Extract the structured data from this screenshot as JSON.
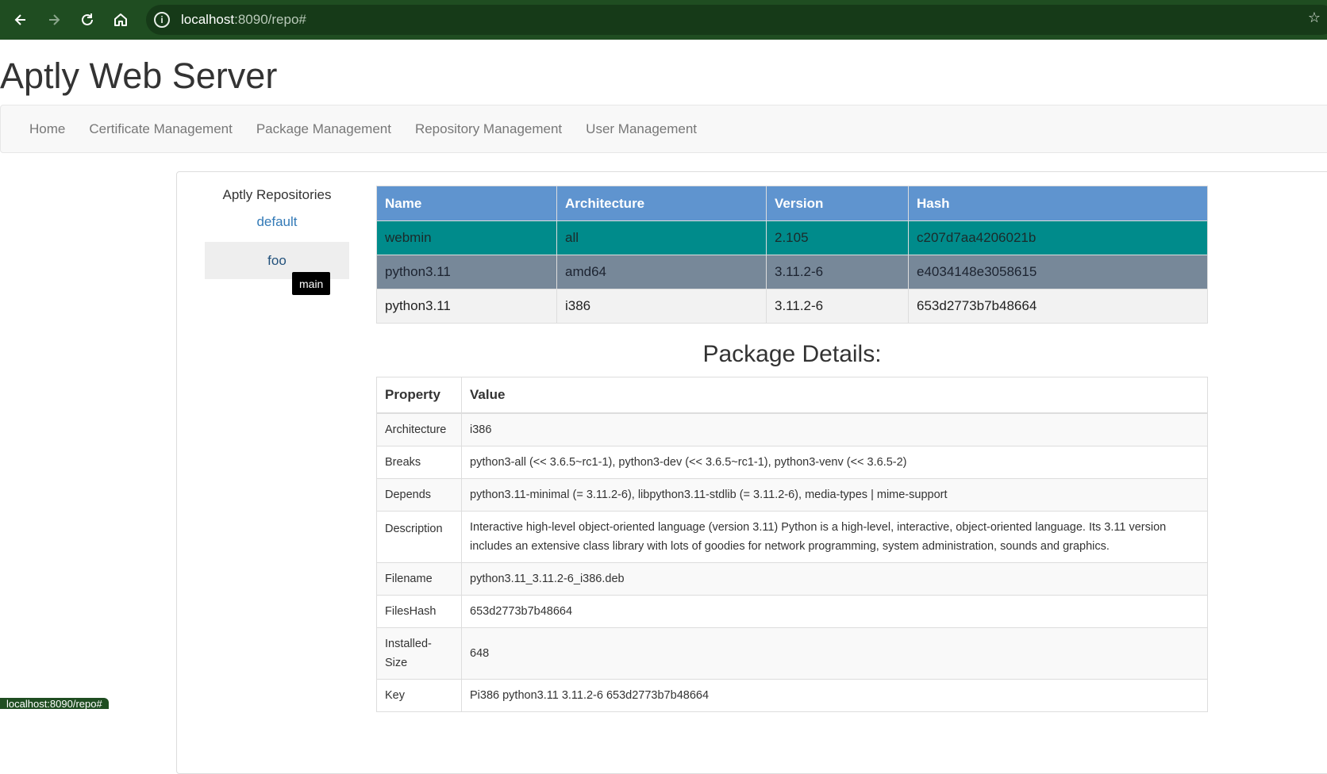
{
  "browser": {
    "url_host": "localhost",
    "url_rest": ":8090/repo#"
  },
  "page": {
    "title": "Aptly Web Server"
  },
  "nav": {
    "items": [
      {
        "label": "Home"
      },
      {
        "label": "Certificate Management"
      },
      {
        "label": "Package Management"
      },
      {
        "label": "Repository Management"
      },
      {
        "label": "User Management"
      }
    ]
  },
  "sidebar": {
    "heading": "Aptly Repositories",
    "repos": [
      "default",
      "foo"
    ],
    "tooltip": "main"
  },
  "packages": {
    "headers": [
      "Name",
      "Architecture",
      "Version",
      "Hash"
    ],
    "rows": [
      [
        "webmin",
        "all",
        "2.105",
        "c207d7aa4206021b"
      ],
      [
        "python3.11",
        "amd64",
        "3.11.2-6",
        "e4034148e3058615"
      ],
      [
        "python3.11",
        "i386",
        "3.11.2-6",
        "653d2773b7b48664"
      ]
    ]
  },
  "details": {
    "title": "Package Details:",
    "headers": [
      "Property",
      "Value"
    ],
    "rows": [
      [
        "Architecture",
        "i386"
      ],
      [
        "Breaks",
        "python3-all (<< 3.6.5~rc1-1), python3-dev (<< 3.6.5~rc1-1), python3-venv (<< 3.6.5-2)"
      ],
      [
        "Depends",
        "python3.11-minimal (= 3.11.2-6), libpython3.11-stdlib (= 3.11.2-6), media-types | mime-support"
      ],
      [
        "Description",
        "Interactive high-level object-oriented language (version 3.11) Python is a high-level, interactive, object-oriented language. Its 3.11 version includes an extensive class library with lots of goodies for network programming, system administration, sounds and graphics."
      ],
      [
        "Filename",
        "python3.11_3.11.2-6_i386.deb"
      ],
      [
        "FilesHash",
        "653d2773b7b48664"
      ],
      [
        "Installed-Size",
        "648"
      ],
      [
        "Key",
        "Pi386 python3.11 3.11.2-6 653d2773b7b48664"
      ]
    ]
  },
  "status_bar": {
    "text": "localhost:8090/repo#"
  },
  "colors": {
    "browser_bar": "#1f4d21",
    "table_header": "#5f94cf",
    "row_selected_teal": "#008b8b",
    "row_hover_slate": "#778899"
  }
}
